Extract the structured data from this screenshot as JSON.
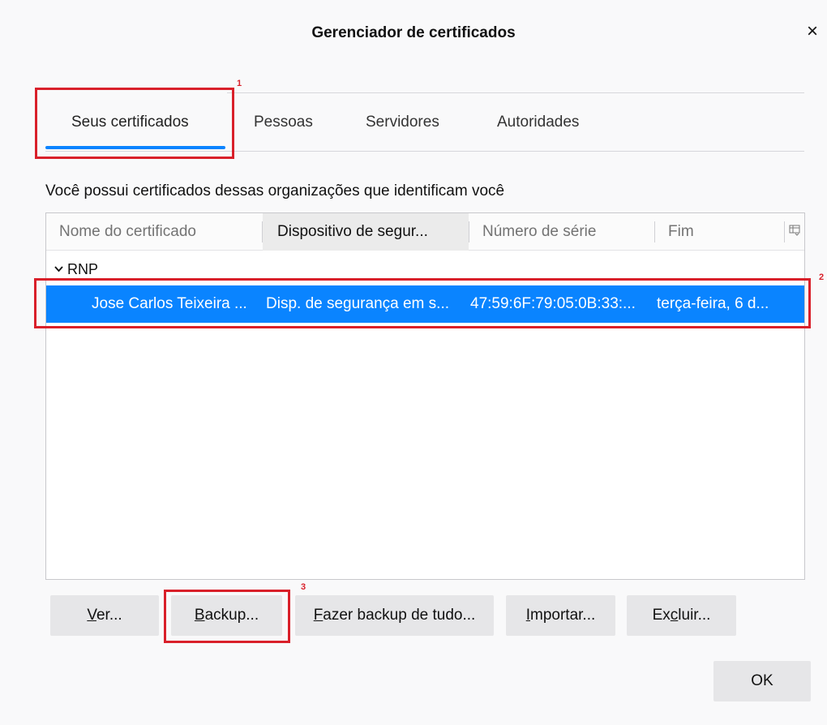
{
  "window": {
    "title": "Gerenciador de certificados",
    "close_label": "×"
  },
  "tabs": [
    {
      "label": "Seus certificados",
      "active": true
    },
    {
      "label": "Pessoas",
      "active": false
    },
    {
      "label": "Servidores",
      "active": false
    },
    {
      "label": "Autoridades",
      "active": false
    }
  ],
  "description": "Você possui certificados dessas organizações que identificam você",
  "table": {
    "columns": [
      "Nome do certificado",
      "Dispositivo de segur...",
      "Número de série",
      "Fim"
    ],
    "sorted_column": 1,
    "groups": [
      {
        "name": "RNP",
        "expanded": true,
        "rows": [
          {
            "cells": [
              "Jose Carlos Teixeira ...",
              "Disp. de segurança em s...",
              "47:59:6F:79:05:0B:33:...",
              "terça-feira, 6 d..."
            ],
            "selected": true
          }
        ]
      }
    ]
  },
  "buttons": {
    "view": {
      "mnemonic": "V",
      "rest": "er..."
    },
    "backup": {
      "mnemonic": "B",
      "rest": "ackup..."
    },
    "backup_all": {
      "mnemonic": "F",
      "rest": "azer backup de tudo..."
    },
    "import": {
      "mnemonic": "I",
      "rest": "mportar..."
    },
    "delete": {
      "pre": "Ex",
      "mnemonic": "c",
      "rest": "luir..."
    },
    "ok": "OK"
  },
  "annotations": [
    {
      "number": "1"
    },
    {
      "number": "2"
    },
    {
      "number": "3"
    }
  ],
  "colors": {
    "accent": "#0a84ff",
    "annotation": "#d9202a",
    "background": "#f9f9fa",
    "button_bg": "#e6e6e8"
  }
}
